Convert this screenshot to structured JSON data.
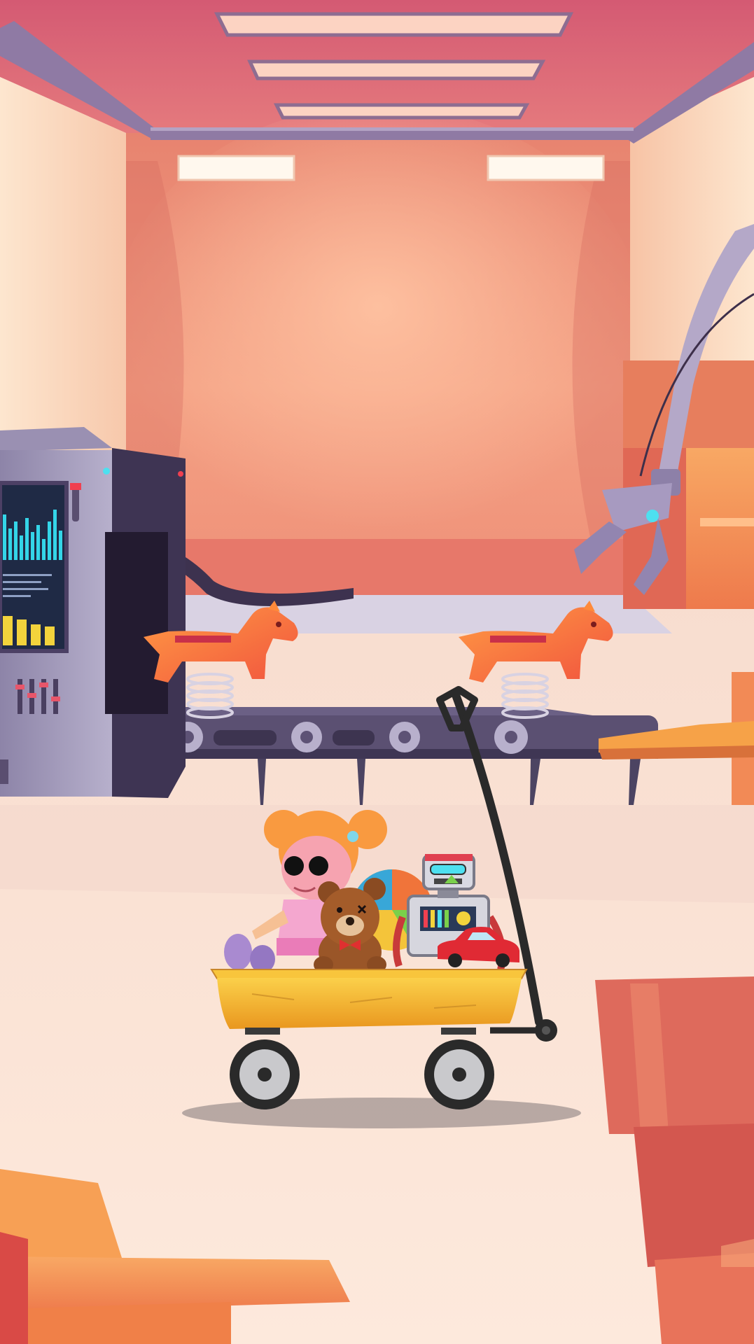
{
  "scene": {
    "name": "toy-factory",
    "palette": {
      "ceiling": "#d9627a",
      "back_wall": "#e98a7c",
      "floor": "#fde9dc",
      "machine": "#6a5f86",
      "conveyor": "#4c4462",
      "wagon": "#f6b531",
      "box": "#f08a58",
      "box_dark": "#d85f56"
    },
    "objects": [
      "ceiling-light-panel",
      "wall-light-panel",
      "control-machine",
      "screen-equalizer",
      "conveyor-belt",
      "rocking-horse",
      "robot-claw-arm",
      "cardboard-box-stack",
      "toy-wagon",
      "doll",
      "teddy-bear",
      "beach-ball",
      "toy-robot",
      "toy-car"
    ]
  }
}
